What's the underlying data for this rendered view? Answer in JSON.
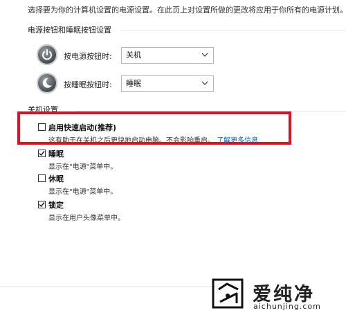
{
  "intro_text": "选择要为你的计算机设置的电源设置。在此页上对设置所做的更改将应用于你所有的电源计划。",
  "power_section": {
    "title": "电源按钮和睡眠按钮设置",
    "rows": [
      {
        "label": "按电源按钮时:",
        "value": "关机",
        "icon": "power-icon"
      },
      {
        "label": "按睡眠按钮时:",
        "value": "睡眠",
        "icon": "sleep-icon"
      }
    ]
  },
  "shutdown_section": {
    "title": "关机设置",
    "options": [
      {
        "label": "启用快速启动(推荐)",
        "checked": false,
        "desc": "这有助于在关机之后更快地启动电脑。不会影响重启。",
        "link": "了解更多信息"
      },
      {
        "label": "睡眠",
        "checked": true,
        "desc": "显示在\"电源\"菜单中。"
      },
      {
        "label": "休眠",
        "checked": false,
        "desc": "显示在\"电源\"菜单中。"
      },
      {
        "label": "锁定",
        "checked": true,
        "desc": "显示在用户头像菜单中。"
      }
    ]
  },
  "watermark": {
    "brand": "爱纯净",
    "url": "aichunjing.com"
  },
  "colors": {
    "highlight": "#d9141f",
    "link": "#0067c0"
  }
}
